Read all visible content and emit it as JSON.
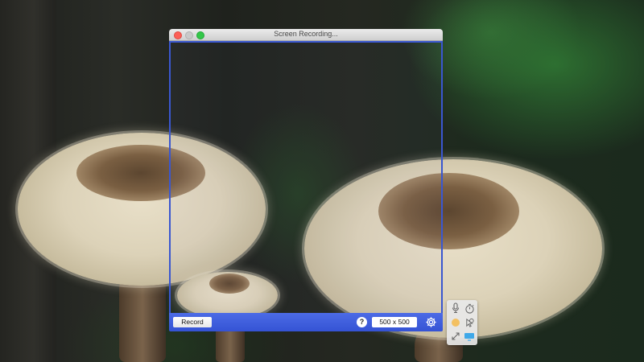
{
  "window": {
    "title": "Screen Recording..."
  },
  "toolbar": {
    "record_label": "Record",
    "help_label": "?",
    "size_label": "500 x 500"
  },
  "palette": {
    "tools": [
      "microphone-icon",
      "timer-icon",
      "cursor-highlight-icon",
      "mouse-click-icon",
      "resize-icon",
      "display-icon"
    ]
  },
  "colors": {
    "frame_accent": "#3a57d0",
    "bar_blue": "#4464e0",
    "close": "#fc5f57",
    "maximize": "#33c748"
  }
}
